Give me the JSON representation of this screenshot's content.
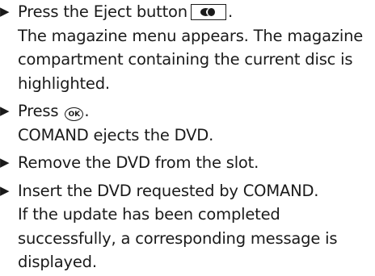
{
  "steps": [
    {
      "action_before": "Press the Eject button",
      "action_icon": "eject-icon",
      "action_after": ".",
      "result_lines": [
        "The magazine menu appears. The magazine",
        "compartment containing the current disc is",
        "highlighted."
      ]
    },
    {
      "action_before": "Press",
      "action_icon": "ok-button-icon",
      "action_icon_label": "OK",
      "action_after": ".",
      "result_lines": [
        "COMAND ejects the DVD."
      ]
    },
    {
      "action": "Remove the DVD from the slot."
    },
    {
      "action": "Insert the DVD requested by COMAND.",
      "result_lines": [
        "If the update has been completed",
        "successfully, a corresponding message is",
        "displayed."
      ]
    }
  ],
  "bullet": "▶"
}
